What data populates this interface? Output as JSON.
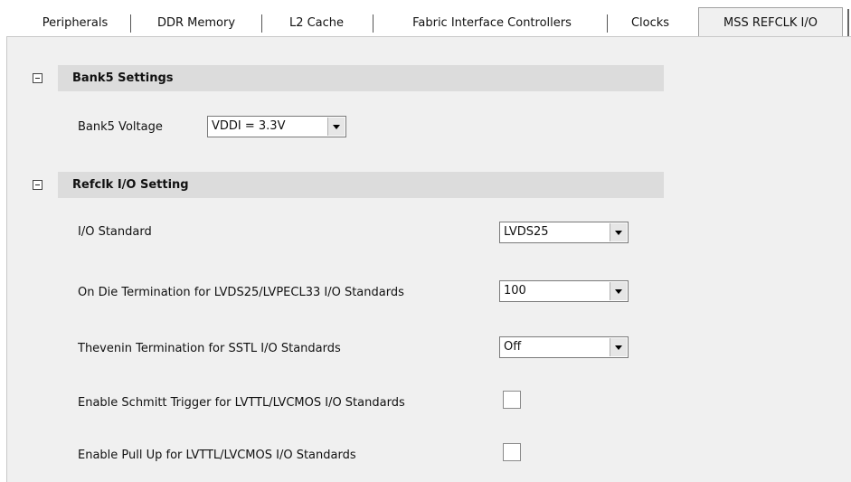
{
  "tabs": [
    {
      "label": "Peripherals"
    },
    {
      "label": "DDR Memory"
    },
    {
      "label": "L2 Cache"
    },
    {
      "label": "Fabric Interface Controllers"
    },
    {
      "label": "Clocks"
    },
    {
      "label": "MSS REFCLK I/O"
    }
  ],
  "bank5": {
    "title": "Bank5 Settings",
    "voltage_label": "Bank5 Voltage",
    "voltage_value": "VDDI = 3.3V"
  },
  "refclk": {
    "title": "Refclk I/O Setting",
    "io_standard_label": "I/O Standard",
    "io_standard_value": "LVDS25",
    "odt_label": "On Die Termination for LVDS25/LVPECL33 I/O Standards",
    "odt_value": "100",
    "thevenin_label": "Thevenin Termination for SSTL I/O Standards",
    "thevenin_value": "Off",
    "schmitt_label": "Enable Schmitt Trigger for LVTTL/LVCMOS I/O Standards",
    "schmitt_checked": false,
    "pullup_label": "Enable Pull Up for LVTTL/LVCMOS I/O Standards",
    "pullup_checked": false
  }
}
